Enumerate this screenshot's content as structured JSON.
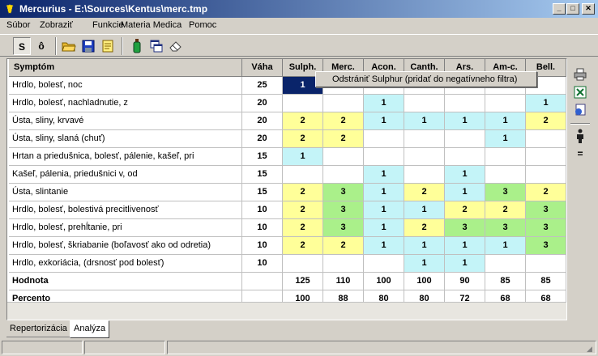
{
  "window": {
    "title": "Mercurius - E:\\Sources\\Kentus\\merc.tmp",
    "minimize": "_",
    "maximize": "□",
    "close": "✕"
  },
  "menu": [
    "Súbor",
    "Zobraziť",
    "Funkcie",
    "Materia Medica",
    "Pomoc"
  ],
  "toolbar": {
    "btn_s": "S",
    "btn_o": "ô",
    "icons": [
      "folder-open-icon",
      "save-disk-icon",
      "note-icon",
      "bottle-icon",
      "windows-icon",
      "eraser-icon"
    ]
  },
  "grid": {
    "headers": {
      "symptom": "Symptóm",
      "weight": "Váha",
      "remedies": [
        "Sulph.",
        "Merc.",
        "Acon.",
        "Canth.",
        "Ars.",
        "Am-c.",
        "Bell."
      ]
    },
    "rows": [
      {
        "name": "Hrdlo, bolesť, noc",
        "weight": "25",
        "values": [
          "1",
          "",
          "",
          "",
          "",
          "",
          ""
        ]
      },
      {
        "name": "Hrdlo, bolesť, nachladnutie, z",
        "weight": "20",
        "values": [
          "",
          "",
          "1",
          "",
          "",
          "",
          "1"
        ]
      },
      {
        "name": "Ústa, sliny, krvavé",
        "weight": "20",
        "values": [
          "2",
          "2",
          "1",
          "1",
          "1",
          "1",
          "2"
        ]
      },
      {
        "name": "Ústa, sliny, slaná (chuť)",
        "weight": "20",
        "values": [
          "2",
          "2",
          "",
          "",
          "",
          "1",
          ""
        ]
      },
      {
        "name": "Hrtan a priedušnica, bolesť, pálenie, kašeľ, pri",
        "weight": "15",
        "values": [
          "1",
          "",
          "",
          "",
          "",
          "",
          ""
        ]
      },
      {
        "name": "Kašeľ, pálenia, priedušnici v, od",
        "weight": "15",
        "values": [
          "",
          "",
          "1",
          "",
          "1",
          "",
          ""
        ]
      },
      {
        "name": "Ústa, slintanie",
        "weight": "15",
        "values": [
          "2",
          "3",
          "1",
          "2",
          "1",
          "3",
          "2"
        ]
      },
      {
        "name": "Hrdlo, bolesť, bolestivá precitlivenosť",
        "weight": "10",
        "values": [
          "2",
          "3",
          "1",
          "1",
          "2",
          "2",
          "3"
        ]
      },
      {
        "name": "Hrdlo, bolesť, prehĺtanie, pri",
        "weight": "10",
        "values": [
          "2",
          "3",
          "1",
          "2",
          "3",
          "3",
          "3"
        ]
      },
      {
        "name": "Hrdlo, bolesť, škriabanie (boľavosť ako od odretia)",
        "weight": "10",
        "values": [
          "2",
          "2",
          "1",
          "1",
          "1",
          "1",
          "3"
        ]
      },
      {
        "name": "Hrdlo, exkoriácia, (drsnosť pod bolesť)",
        "weight": "10",
        "values": [
          "",
          "",
          "",
          "1",
          "1",
          "",
          ""
        ]
      }
    ],
    "totals": {
      "label": "Hodnota",
      "values": [
        "125",
        "110",
        "100",
        "100",
        "90",
        "85",
        "85"
      ]
    },
    "percent": {
      "label": "Percento",
      "values": [
        "100",
        "88",
        "80",
        "80",
        "72",
        "68",
        "68"
      ]
    },
    "selected": {
      "row": 0,
      "col": 0
    }
  },
  "context_menu": {
    "item": "Odstrániť Sulphur (pridať do negatívneho filtra)"
  },
  "side_toolbar": {
    "icons": [
      "printer-icon",
      "excel-icon",
      "export-icon",
      "person-icon"
    ],
    "equals": "="
  },
  "tabs": [
    "Repertorizácia",
    "Analýza"
  ],
  "active_tab": 1,
  "colors": {
    "grade1": "#c4f4f8",
    "grade2": "#ffff99",
    "grade3": "#aaf08a",
    "selection": "#0a246a"
  }
}
